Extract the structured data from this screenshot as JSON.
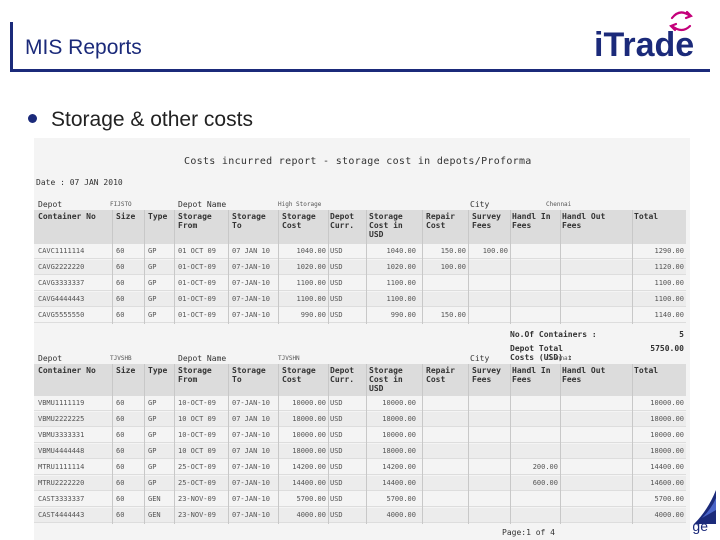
{
  "header": {
    "title": "MIS Reports",
    "logo_text": "iTrade",
    "brand_color": "#1b2a7a",
    "logo_accent": "#c4007a"
  },
  "bullet": {
    "text": "Storage & other costs"
  },
  "report": {
    "title": "Costs incurred report - storage cost in depots/Proforma",
    "date": "Date : 07 JAN 2010",
    "page": "Page:1 of 4",
    "columns": [
      "Container No",
      "Size",
      "Type",
      "Storage\nFrom",
      "Storage\nTo",
      "Storage\nCost",
      "Depot\nCurr.",
      "Storage\nCost in\nUSD",
      "Repair\nCost",
      "Survey\nFees",
      "Handl In\nFees",
      "Handl Out\nFees",
      "Total"
    ],
    "sections": [
      {
        "depot_label": "Depot",
        "depot_code": "FIJSTO",
        "depot_name_label": "Depot Name",
        "depot_name": "High Storage",
        "city_label": "City",
        "city": "Chennai",
        "rows": [
          [
            "CAVC1111114",
            "60",
            "GP",
            "01 OCT 09",
            "07 JAN 10",
            "1040.00",
            "USD",
            "1040.00",
            "150.00",
            "100.00",
            "",
            "",
            "1290.00"
          ],
          [
            "CAVG2222220",
            "60",
            "GP",
            "01-OCT-09",
            "07-JAN-10",
            "1020.00",
            "USD",
            "1020.00",
            "100.00",
            "",
            "",
            "",
            "1120.00"
          ],
          [
            "CAVG3333337",
            "60",
            "GP",
            "01-OCT-09",
            "07-JAN-10",
            "1100.00",
            "USD",
            "1100.00",
            "",
            "",
            "",
            "",
            "1100.00"
          ],
          [
            "CAVG4444443",
            "60",
            "GP",
            "01-OCT-09",
            "07-JAN-10",
            "1100.00",
            "USD",
            "1100.00",
            "",
            "",
            "",
            "",
            "1100.00"
          ],
          [
            "CAVG5555550",
            "60",
            "GP",
            "01-OCT-09",
            "07-JAN-10",
            "990.00",
            "USD",
            "990.00",
            "150.00",
            "",
            "",
            "",
            "1140.00"
          ]
        ],
        "summary": {
          "containers_label": "No.Of Containers :",
          "containers_value": "5",
          "total_label": "Depot Total Costs (USD) :",
          "total_value": "5750.00"
        }
      },
      {
        "depot_label": "Depot",
        "depot_code": "TJVSHB",
        "depot_name_label": "Depot Name",
        "depot_name": "TJVSHN",
        "city_label": "City",
        "city": "Chennai",
        "rows": [
          [
            "VBMU1111119",
            "60",
            "GP",
            "10-OCT-09",
            "07-JAN-10",
            "10000.00",
            "USD",
            "10000.00",
            "",
            "",
            "",
            "",
            "10000.00"
          ],
          [
            "VBMU2222225",
            "60",
            "GP",
            "10 OCT 09",
            "07 JAN 10",
            "18000.00",
            "USD",
            "18000.00",
            "",
            "",
            "",
            "",
            "18000.00"
          ],
          [
            "VBMU3333331",
            "60",
            "GP",
            "10-OCT-09",
            "07-JAN-10",
            "10000.00",
            "USD",
            "10000.00",
            "",
            "",
            "",
            "",
            "10000.00"
          ],
          [
            "VBMU4444448",
            "60",
            "GP",
            "10 OCT 09",
            "07 JAN 10",
            "18000.00",
            "USD",
            "18000.00",
            "",
            "",
            "",
            "",
            "18000.00"
          ],
          [
            "MTRU1111114",
            "60",
            "GP",
            "25-OCT-09",
            "07-JAN-10",
            "14200.00",
            "USD",
            "14200.00",
            "",
            "",
            "200.00",
            "",
            "14400.00"
          ],
          [
            "MTRU2222220",
            "60",
            "GP",
            "25-OCT-09",
            "07-JAN-10",
            "14400.00",
            "USD",
            "14400.00",
            "",
            "",
            "600.00",
            "",
            "14600.00"
          ],
          [
            "CAST3333337",
            "60",
            "GEN",
            "23-NOV-09",
            "07-JAN-10",
            "5700.00",
            "USD",
            "5700.00",
            "",
            "",
            "",
            "",
            "5700.00"
          ],
          [
            "CAST4444443",
            "60",
            "GEN",
            "23-NOV-09",
            "07-JAN-10",
            "4000.00",
            "USD",
            "4000.00",
            "",
            "",
            "",
            "",
            "4000.00"
          ]
        ]
      }
    ]
  }
}
